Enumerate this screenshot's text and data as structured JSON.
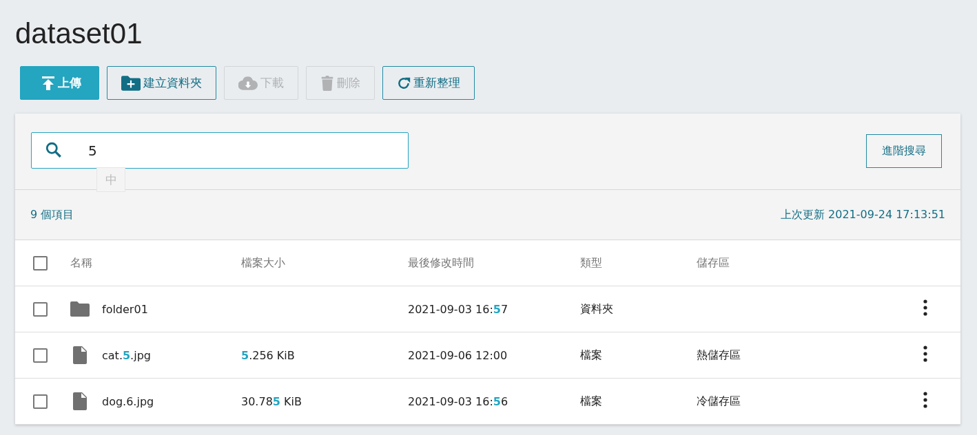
{
  "title": "dataset01",
  "toolbar": [
    {
      "kind": "upload",
      "label": "上傳",
      "primary": true,
      "disabled": false
    },
    {
      "kind": "new-folder",
      "label": "建立資料夾",
      "primary": false,
      "disabled": false
    },
    {
      "kind": "download",
      "label": "下載",
      "primary": false,
      "disabled": true
    },
    {
      "kind": "delete",
      "label": "刪除",
      "primary": false,
      "disabled": true
    },
    {
      "kind": "refresh",
      "label": "重新整理",
      "primary": false,
      "disabled": false
    }
  ],
  "search": {
    "value": "5",
    "ime_indicator": "中",
    "advanced_button": "進階搜尋"
  },
  "summary": {
    "count": "9 個項目",
    "last_updated": "上次更新 2021-09-24 17:13:51"
  },
  "table": {
    "select_all_checked": false,
    "columns": [
      "名稱",
      "檔案大小",
      "最後修改時間",
      "類型",
      "儲存區"
    ],
    "rows": [
      {
        "kind": "folder",
        "checked": false,
        "name": "folder01",
        "size": "",
        "modified": "2021-09-03 16:**5**7",
        "type": "資料夾",
        "storage": ""
      },
      {
        "kind": "file",
        "checked": false,
        "name": "cat.**5**.jpg",
        "size": "**5**.256 KiB",
        "modified": "2021-09-06 12:00",
        "type": "檔案",
        "storage": "熱儲存區"
      },
      {
        "kind": "file",
        "checked": false,
        "name": "dog.6.jpg",
        "size": "30.78**5** KiB",
        "modified": "2021-09-03 16:**5**6",
        "type": "檔案",
        "storage": "冷儲存區"
      }
    ]
  }
}
